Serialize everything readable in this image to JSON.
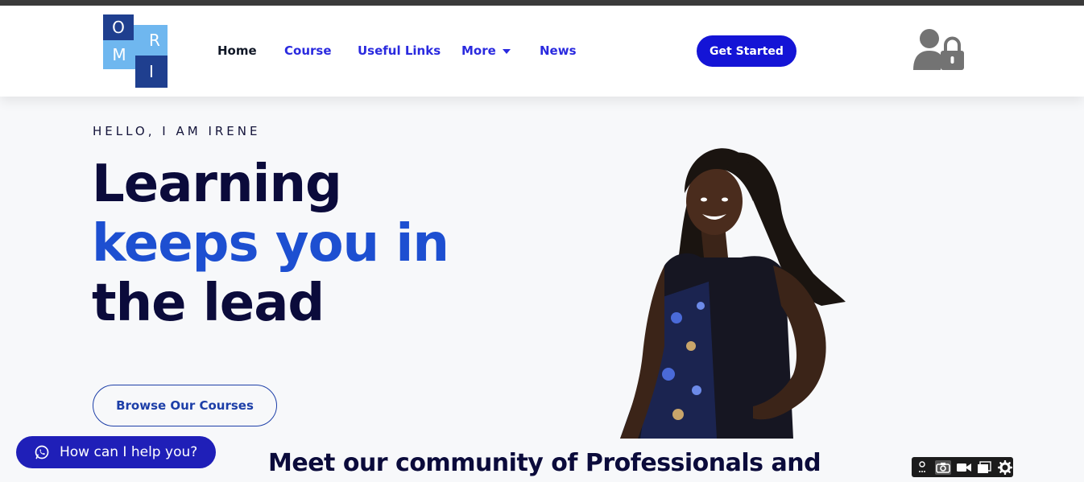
{
  "logo": {
    "letters": [
      "O",
      "R",
      "M",
      "I"
    ]
  },
  "nav": {
    "items": [
      {
        "label": "Home",
        "active": true
      },
      {
        "label": "Course",
        "active": false
      },
      {
        "label": "Useful Links",
        "active": false
      },
      {
        "label": "More",
        "active": false,
        "has_dropdown": true
      },
      {
        "label": "News",
        "active": false
      }
    ],
    "cta_label": "Get Started",
    "account_icon": "user-lock-icon"
  },
  "hero": {
    "eyebrow": "HELLO, I AM IRENE",
    "title_line1": "Learning",
    "title_line2": "keeps you in",
    "title_line3": "the lead",
    "browse_label": "Browse Our Courses",
    "portrait": "woman-portrait-image"
  },
  "section": {
    "heading": "Meet our community of Professionals and"
  },
  "chat": {
    "label": "How can I help you?",
    "icon": "whatsapp-icon"
  },
  "toolbar": {
    "icons": [
      "extension-icon",
      "camera-icon",
      "video-icon",
      "window-icon",
      "gear-icon"
    ]
  },
  "colors": {
    "primary": "#1414d6",
    "accent_blue": "#1d4fd1",
    "dark_navy": "#0b0b3b",
    "logo_dark": "#1f3f8f",
    "logo_light": "#6fb7ef"
  }
}
